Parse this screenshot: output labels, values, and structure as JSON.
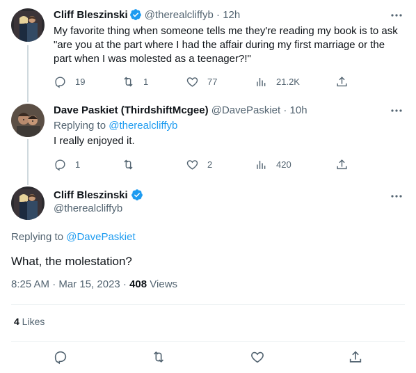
{
  "tweet1": {
    "name": "Cliff Bleszinski",
    "handle": "@therealcliffyb",
    "time": "12h",
    "text": "My favorite thing when someone tells me they're reading my book is to ask \"are you at the part where I had the affair during my first marriage or the part when I was molested as a teenager?!\"",
    "replies": "19",
    "retweets": "1",
    "likes": "77",
    "views": "21.2K"
  },
  "tweet2": {
    "name": "Dave Paskiet (ThirdshiftMcgee)",
    "handle": "@DavePaskiet",
    "time": "10h",
    "replying_label": "Replying to",
    "replying_to": "@therealcliffyb",
    "text": "I really enjoyed it.",
    "replies": "1",
    "retweets": "",
    "likes": "2",
    "views": "420"
  },
  "main": {
    "name": "Cliff Bleszinski",
    "handle": "@therealcliffyb",
    "replying_label": "Replying to",
    "replying_to": "@DavePaskiet",
    "text": "What, the molestation?",
    "timestamp": "8:25 AM · Mar 15, 2023 · ",
    "views_count": "408",
    "views_label": " Views",
    "likes_count": "4",
    "likes_label": " Likes"
  },
  "colors": {
    "accent": "#1d9bf0",
    "muted": "#536471",
    "text": "#0f1419",
    "border": "#eff3f4"
  }
}
